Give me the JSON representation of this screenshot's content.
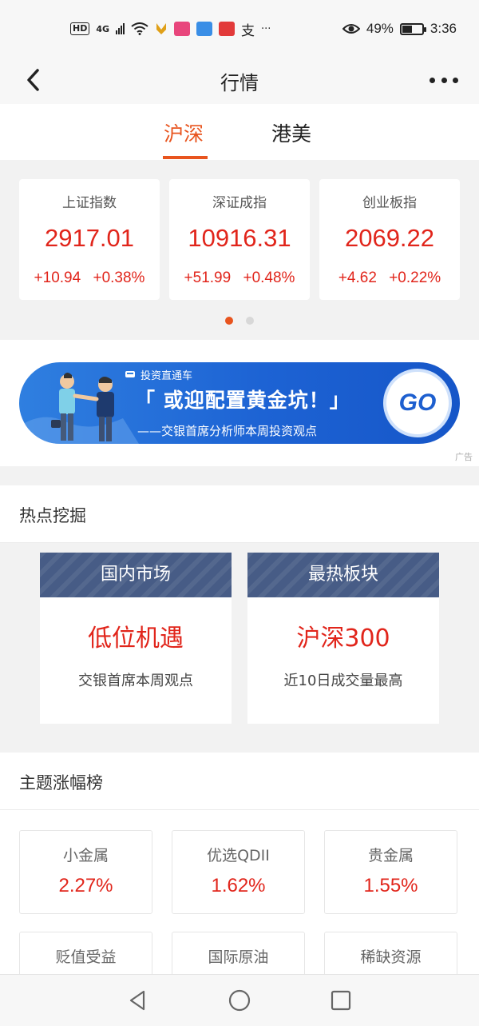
{
  "status_bar": {
    "network": "HD",
    "signal": "4G",
    "more": "···",
    "battery_pct": "49%",
    "battery_level": 0.49,
    "time": "3:36"
  },
  "app_bar": {
    "title": "行情"
  },
  "tabs": [
    {
      "label": "沪深",
      "active": true
    },
    {
      "label": "港美",
      "active": false
    }
  ],
  "indices": [
    {
      "name": "上证指数",
      "value": "2917.01",
      "change": "+10.94",
      "pct": "+0.38%"
    },
    {
      "name": "深证成指",
      "value": "10916.31",
      "change": "+51.99",
      "pct": "+0.48%"
    },
    {
      "name": "创业板指",
      "value": "2069.22",
      "change": "+4.62",
      "pct": "+0.22%"
    }
  ],
  "carousel": {
    "pages": 2,
    "current": 1
  },
  "banner": {
    "tag": "投资直通车",
    "headline": "「 或迎配置黄金坑！」",
    "subtitle": "——交银首席分析师本周投资观点",
    "button": "GO",
    "ad_label": "广告"
  },
  "hot_section": {
    "title": "热点挖掘",
    "cards": [
      {
        "header": "国内市场",
        "main": "低位机遇",
        "sub": "交银首席本周观点"
      },
      {
        "header": "最热板块",
        "main": "沪深300",
        "sub": "近10日成交量最高"
      }
    ]
  },
  "theme_section": {
    "title": "主题涨幅榜",
    "items": [
      {
        "name": "小金属",
        "value": "2.27%"
      },
      {
        "name": "优选QDII",
        "value": "1.62%"
      },
      {
        "name": "贵金属",
        "value": "1.55%"
      },
      {
        "name": "贬值受益",
        "value": ""
      },
      {
        "name": "国际原油",
        "value": ""
      },
      {
        "name": "稀缺资源",
        "value": ""
      }
    ]
  },
  "colors": {
    "accent": "#e8541e",
    "up": "#e1251b",
    "hot_header": "#475c86",
    "banner": "#1d63d4"
  },
  "nav_bar": {
    "icons": [
      "back-triangle-icon",
      "home-circle-icon",
      "recents-square-icon"
    ]
  }
}
